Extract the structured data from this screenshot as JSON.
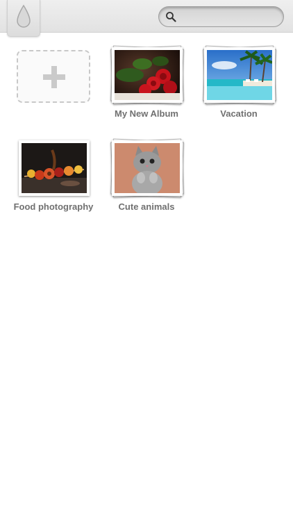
{
  "header": {
    "logo_icon": "water-drop-icon",
    "search": {
      "placeholder": "",
      "value": "",
      "icon": "search-icon"
    }
  },
  "add_album": {
    "icon": "plus-icon"
  },
  "albums": [
    {
      "label": "My New Album",
      "thumb": "red-roses-photo"
    },
    {
      "label": "Vacation",
      "thumb": "tropical-beach-photo"
    },
    {
      "label": "Food photography",
      "thumb": "food-photo"
    },
    {
      "label": "Cute animals",
      "thumb": "kitten-photo"
    }
  ]
}
